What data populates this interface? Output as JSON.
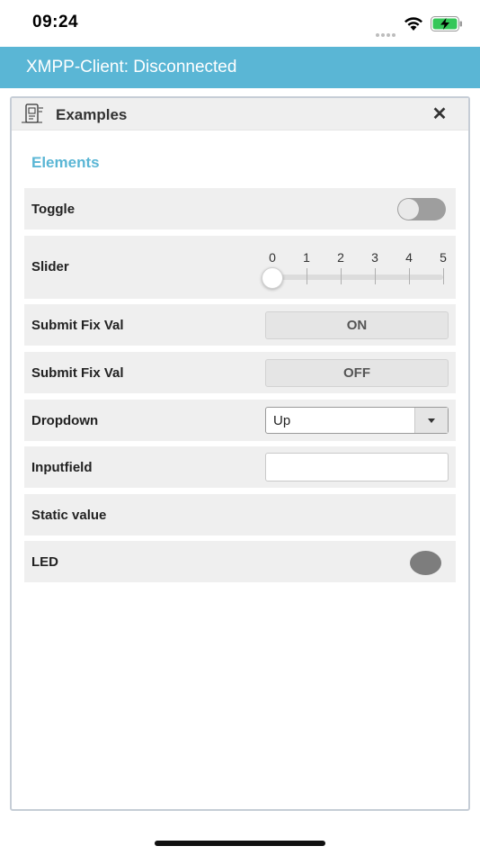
{
  "status_bar": {
    "time": "09:24",
    "icons": [
      "signal-icon",
      "wifi-icon",
      "battery-charging-icon"
    ]
  },
  "header": {
    "title": "XMPP-Client: Disconnected",
    "color": "#5ab6d5"
  },
  "panel": {
    "title": "Examples",
    "icon": "device-icon",
    "close_icon": "close-icon",
    "close_glyph": "✕"
  },
  "section": {
    "title": "Elements"
  },
  "rows": {
    "toggle": {
      "label": "Toggle",
      "state": "off"
    },
    "slider": {
      "label": "Slider",
      "ticks": [
        "0",
        "1",
        "2",
        "3",
        "4",
        "5"
      ],
      "value": 0
    },
    "submit_on": {
      "label": "Submit Fix Val",
      "button": "ON"
    },
    "submit_off": {
      "label": "Submit Fix Val",
      "button": "OFF"
    },
    "dropdown": {
      "label": "Dropdown",
      "selected": "Up"
    },
    "inputfield": {
      "label": "Inputfield",
      "value": "",
      "placeholder": ""
    },
    "static": {
      "label": "Static value",
      "value": ""
    },
    "led": {
      "label": "LED",
      "color": "#7d7d7d"
    }
  }
}
